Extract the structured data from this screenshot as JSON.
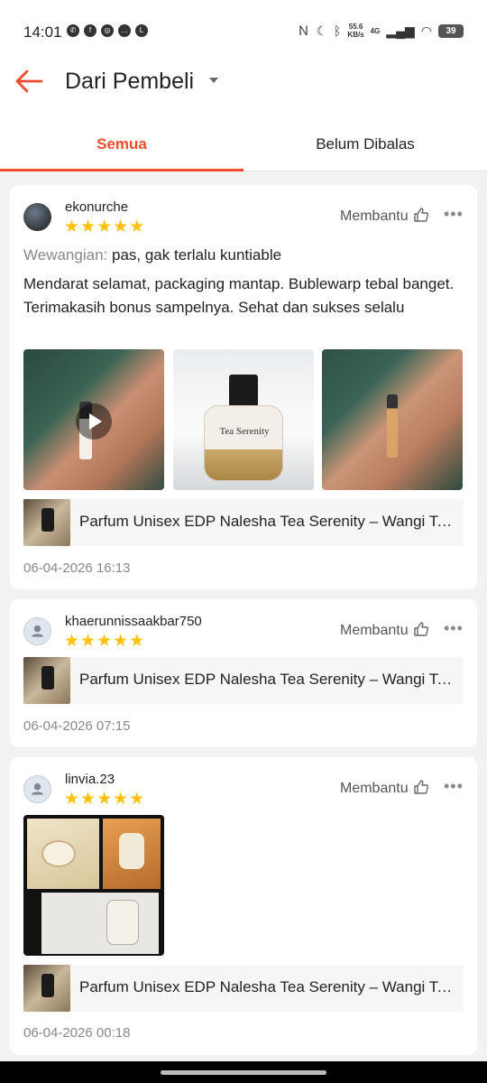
{
  "status_bar": {
    "time": "14:01",
    "net_speed_value": "55.6",
    "net_speed_unit": "KB/s",
    "network": "4G",
    "battery": "39",
    "icons": [
      "whatsapp-icon",
      "facebook-icon",
      "instagram-icon",
      "chat-icon",
      "line-icon",
      "nfc-icon",
      "moon-icon",
      "bluetooth-icon",
      "signal-icon",
      "wifi-icon"
    ]
  },
  "header": {
    "title": "Dari Pembeli",
    "accent": "#ee4d2d"
  },
  "tabs": [
    {
      "label": "Semua",
      "active": true
    },
    {
      "label": "Belum Dibalas",
      "active": false
    }
  ],
  "reviews": [
    {
      "username": "ekonurche",
      "rating": 5,
      "helpful_label": "Membantu",
      "attribute_label": "Wewangian:",
      "attribute_value": "pas, gak terlalu kuntiable",
      "comment_line1": "Mendarat selamat, packaging mantap. Bublewarp tebal banget.",
      "comment_line2": "Terimakasih bonus sampelnya. Sehat dan sukses selalu",
      "media_bottle_label": "Tea Serenity",
      "product_name": "Parfum Unisex EDP Nalesha Tea Serenity – Wangi Teh Hijau & Buah",
      "date": "06-04-2026 16:13"
    },
    {
      "username": "khaerunnissaakbar750",
      "rating": 5,
      "helpful_label": "Membantu",
      "product_name": "Parfum Unisex EDP Nalesha Tea Serenity – Wangi Teh Hijau & Buah",
      "date": "06-04-2026 07:15"
    },
    {
      "username": "linvia.23",
      "rating": 5,
      "helpful_label": "Membantu",
      "product_name": "Parfum Unisex EDP Nalesha Tea Serenity – Wangi Teh Hijau & Buah",
      "date": "06-04-2026 00:18"
    }
  ]
}
